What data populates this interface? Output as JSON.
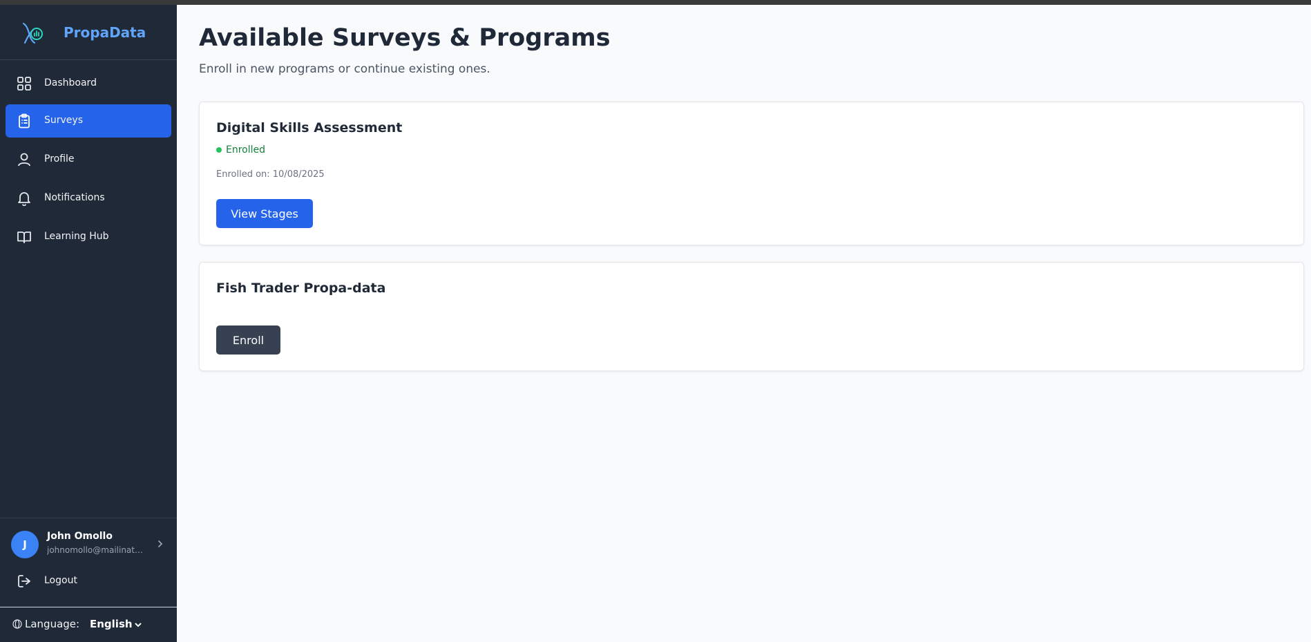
{
  "brand": {
    "name": "PropaData",
    "logo_icon": "dna-chart-icon"
  },
  "sidebar": {
    "items": [
      {
        "label": "Dashboard",
        "icon": "grid-icon",
        "active": false
      },
      {
        "label": "Surveys",
        "icon": "clipboard-icon",
        "active": true
      },
      {
        "label": "Profile",
        "icon": "user-icon",
        "active": false
      },
      {
        "label": "Notifications",
        "icon": "bell-icon",
        "active": false
      },
      {
        "label": "Learning Hub",
        "icon": "book-icon",
        "active": false
      }
    ],
    "user": {
      "initial": "J",
      "name": "John Omollo",
      "email": "johnomollo@mailinator.com"
    },
    "logout_label": "Logout",
    "language": {
      "label": "Language:",
      "selected": "English"
    }
  },
  "main": {
    "title": "Available Surveys & Programs",
    "subtitle": "Enroll in new programs or continue existing ones.",
    "programs": [
      {
        "title": "Digital Skills Assessment",
        "status": "Enrolled",
        "enrolled_on": "Enrolled on: 10/08/2025",
        "action": "View Stages"
      },
      {
        "title": "Fish Trader Propa-data",
        "action": "Enroll"
      }
    ]
  },
  "colors": {
    "sidebar_bg": "#1f2937",
    "accent": "#2563eb",
    "brand": "#60a5fa",
    "enrolled": "#15803d"
  }
}
